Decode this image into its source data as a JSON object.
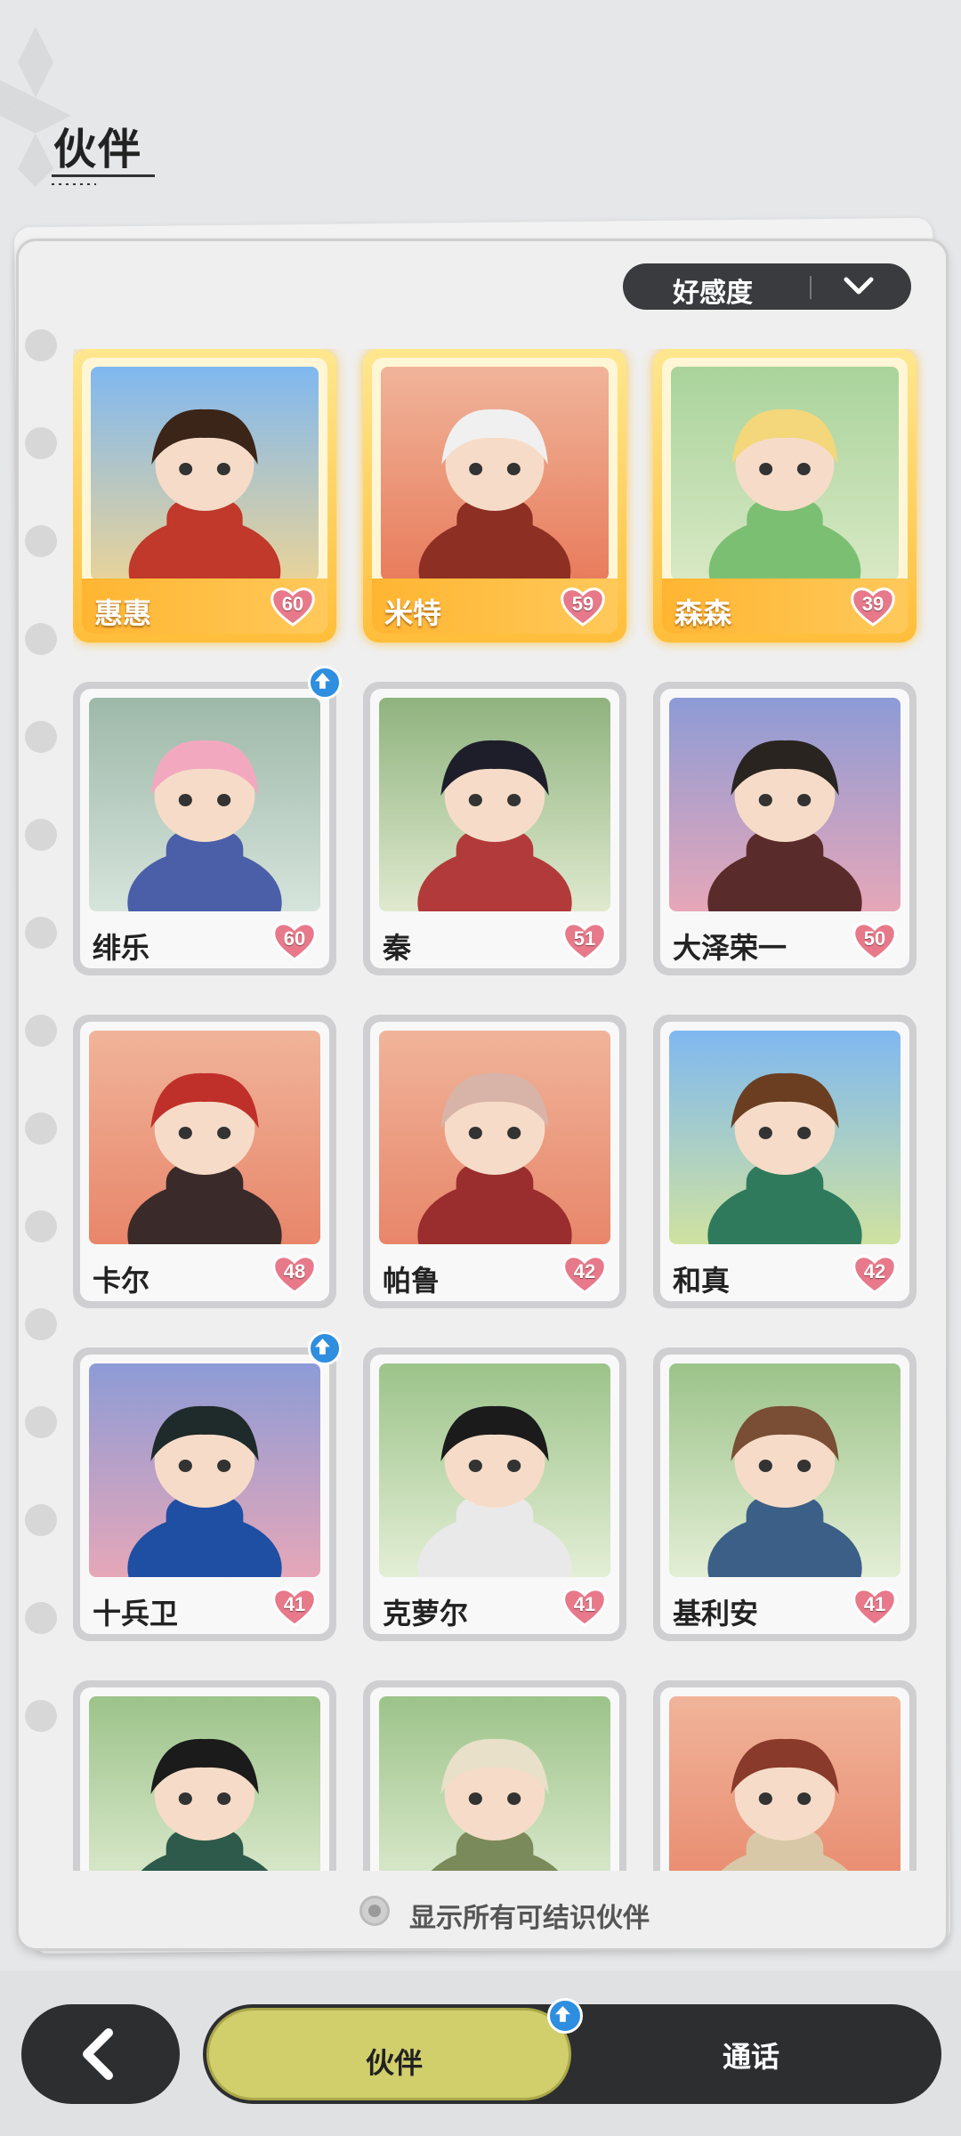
{
  "header": {
    "title": "伙伴"
  },
  "sort": {
    "label": "好感度",
    "icon": "chevron-down-icon"
  },
  "partners": [
    {
      "name": "惠惠",
      "affection": "60",
      "featured": true,
      "upgrade": false,
      "bg": [
        "#7fb8f0",
        "#e8d39a"
      ],
      "hair": "#3b2418",
      "outfit": "#c0392b"
    },
    {
      "name": "米特",
      "affection": "59",
      "featured": true,
      "upgrade": false,
      "bg": [
        "#f0b49a",
        "#e87c5c"
      ],
      "hair": "#f0f0f0",
      "outfit": "#8e2f24"
    },
    {
      "name": "森森",
      "affection": "39",
      "featured": true,
      "upgrade": false,
      "bg": [
        "#a9d39b",
        "#d8e8c4"
      ],
      "hair": "#f3d77a",
      "outfit": "#7bbf73"
    },
    {
      "name": "绯乐",
      "affection": "60",
      "featured": false,
      "upgrade": true,
      "bg": [
        "#9db8a8",
        "#d6e4dc"
      ],
      "hair": "#f2a9c0",
      "outfit": "#4a5fa8"
    },
    {
      "name": "秦",
      "affection": "51",
      "featured": false,
      "upgrade": false,
      "bg": [
        "#8fb37e",
        "#dfe9cf"
      ],
      "hair": "#1e1e2a",
      "outfit": "#b23a3a"
    },
    {
      "name": "大泽荣一",
      "affection": "50",
      "featured": false,
      "upgrade": false,
      "bg": [
        "#8d9bd6",
        "#e6a7b8"
      ],
      "hair": "#2a2420",
      "outfit": "#5a2b2b"
    },
    {
      "name": "卡尔",
      "affection": "48",
      "featured": false,
      "upgrade": false,
      "bg": [
        "#f0b49a",
        "#e8866a"
      ],
      "hair": "#c0302a",
      "outfit": "#3a2a2a"
    },
    {
      "name": "帕鲁",
      "affection": "42",
      "featured": false,
      "upgrade": false,
      "bg": [
        "#f0b49a",
        "#e8866a"
      ],
      "hair": "#d8b4a8",
      "outfit": "#9a2e2e"
    },
    {
      "name": "和真",
      "affection": "42",
      "featured": false,
      "upgrade": false,
      "bg": [
        "#7fb8f0",
        "#cfe2a0"
      ],
      "hair": "#6b3e22",
      "outfit": "#2f7a5c"
    },
    {
      "name": "十兵卫",
      "affection": "41",
      "featured": false,
      "upgrade": true,
      "bg": [
        "#8d9bd6",
        "#e6a7b8"
      ],
      "hair": "#1f2a2a",
      "outfit": "#1f4fa3"
    },
    {
      "name": "克萝尔",
      "affection": "41",
      "featured": false,
      "upgrade": false,
      "bg": [
        "#9cc38a",
        "#e3eed5"
      ],
      "hair": "#1b1b1b",
      "outfit": "#e9e9e9"
    },
    {
      "name": "基利安",
      "affection": "41",
      "featured": false,
      "upgrade": false,
      "bg": [
        "#9cc38a",
        "#e3eed5"
      ],
      "hair": "#7a4e34",
      "outfit": "#3b5f86"
    },
    {
      "name": "",
      "affection": "",
      "featured": false,
      "upgrade": false,
      "bg": [
        "#9cc38a",
        "#e3eed5"
      ],
      "hair": "#1b1b1b",
      "outfit": "#2d5a4a"
    },
    {
      "name": "",
      "affection": "",
      "featured": false,
      "upgrade": false,
      "bg": [
        "#9cc38a",
        "#e3eed5"
      ],
      "hair": "#e8e0c8",
      "outfit": "#7a8a5a"
    },
    {
      "name": "",
      "affection": "",
      "featured": false,
      "upgrade": false,
      "bg": [
        "#f0b49a",
        "#e8866a"
      ],
      "hair": "#8a3a2a",
      "outfit": "#d8c8a8"
    }
  ],
  "toggle": {
    "label": "显示所有可结识伙伴",
    "checked": false
  },
  "nav": {
    "back_icon": "back-arrow-icon",
    "tab_active": "伙伴",
    "tab_other": "通话",
    "tab_badge_icon": "upgrade-arrow-icon"
  },
  "colors": {
    "gold": "#ffbe3a",
    "heart": "#e7798a",
    "tab_active": "#d0cf6c",
    "dark": "#2d2e30",
    "badge": "#2e8ee0"
  }
}
